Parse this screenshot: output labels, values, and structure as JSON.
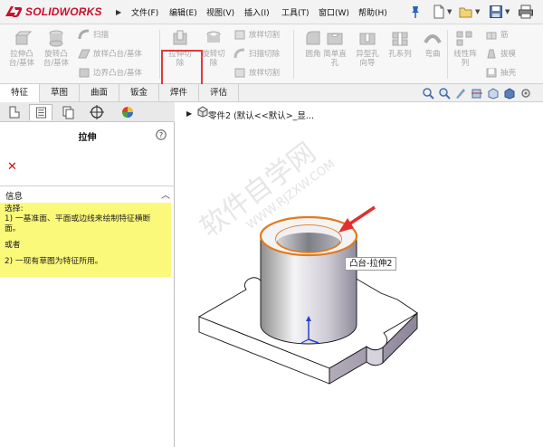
{
  "app": {
    "logo_text": "SOLIDWORKS",
    "brand_color": "#c8102e"
  },
  "menu": {
    "items": [
      "文件(F)",
      "编辑(E)",
      "视图(V)",
      "插入(I)",
      "工具(T)",
      "窗口(W)",
      "帮助(H)"
    ]
  },
  "ribbon": {
    "big_buttons": [
      {
        "label_lines": [
          "拉伸凸",
          "台/基体"
        ],
        "icon": "extruded-boss-icon"
      },
      {
        "label_lines": [
          "旋转凸",
          "台/基体"
        ],
        "icon": "revolved-boss-icon"
      },
      {
        "label_lines": [
          "拉伸切",
          "除"
        ],
        "icon": "extruded-cut-icon"
      },
      {
        "label_lines": [
          "旋转切",
          "除"
        ],
        "icon": "revolved-cut-icon"
      },
      {
        "label_lines": [
          "圆角"
        ],
        "icon": "fillet-icon"
      },
      {
        "label_lines": [
          "简单直",
          "孔"
        ],
        "icon": "simple-hole-icon"
      },
      {
        "label_lines": [
          "异型孔",
          "向导"
        ],
        "icon": "hole-wizard-icon"
      },
      {
        "label_lines": [
          "孔系列"
        ],
        "icon": "hole-series-icon"
      },
      {
        "label_lines": [
          "弯曲"
        ],
        "icon": "flex-icon"
      },
      {
        "label_lines": [
          "线性阵",
          "列"
        ],
        "icon": "linear-pattern-icon"
      }
    ],
    "small_buttons_col1": [
      "扫描",
      "放样凸台/基体",
      "边界凸台/基体"
    ],
    "small_buttons_col2": [
      "放样切割",
      "扫描切除",
      "放样切割"
    ],
    "small_buttons_col3": [
      "筋",
      "拔模",
      "抽壳"
    ]
  },
  "tabs": {
    "items": [
      "特征",
      "草图",
      "曲面",
      "钣金",
      "焊件",
      "评估"
    ],
    "active": "特征"
  },
  "property_manager": {
    "title": "拉伸",
    "info_label": "信息",
    "info_lines": [
      "选择:",
      "1) 一基准面、平面或边线来绘制特征横断",
      "面。",
      "",
      "或者",
      "",
      "2) 一现有草图为特征所用。"
    ]
  },
  "feature_tree": {
    "top_item": "零件2 (默认<<默认>_显..."
  },
  "viewport": {
    "tooltip": "凸台-拉伸2",
    "highlight_color": "#e07b20",
    "arrow_color": "#e03030",
    "watermark_big": "软件自学网",
    "watermark_small": "WWW.RJZXW.COM"
  }
}
